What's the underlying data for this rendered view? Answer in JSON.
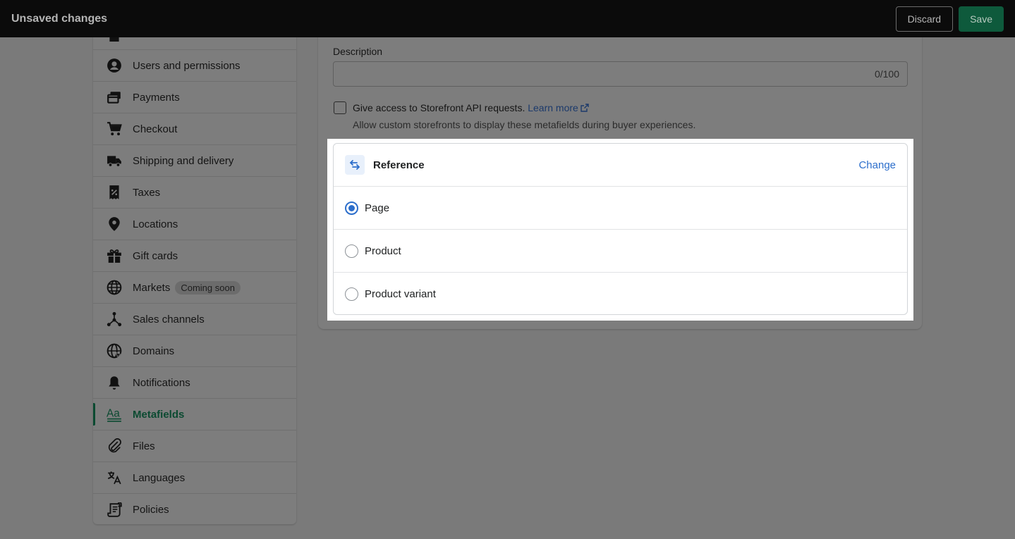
{
  "topbar": {
    "title": "Unsaved changes",
    "discard_label": "Discard",
    "save_label": "Save"
  },
  "sidebar": {
    "items": [
      {
        "label": "Users and permissions",
        "icon": "user-circle-icon"
      },
      {
        "label": "Payments",
        "icon": "payments-icon"
      },
      {
        "label": "Checkout",
        "icon": "cart-icon"
      },
      {
        "label": "Shipping and delivery",
        "icon": "truck-icon"
      },
      {
        "label": "Taxes",
        "icon": "tax-receipt-icon"
      },
      {
        "label": "Locations",
        "icon": "location-pin-icon"
      },
      {
        "label": "Gift cards",
        "icon": "gift-icon"
      },
      {
        "label": "Markets",
        "icon": "globe-icon",
        "badge": "Coming soon"
      },
      {
        "label": "Sales channels",
        "icon": "channels-icon"
      },
      {
        "label": "Domains",
        "icon": "globe-domain-icon"
      },
      {
        "label": "Notifications",
        "icon": "bell-icon"
      },
      {
        "label": "Metafields",
        "icon": "metafields-icon",
        "active": true
      },
      {
        "label": "Files",
        "icon": "paperclip-icon"
      },
      {
        "label": "Languages",
        "icon": "translate-icon"
      },
      {
        "label": "Policies",
        "icon": "policy-document-icon"
      }
    ]
  },
  "form": {
    "description_label": "Description",
    "description_value": "",
    "description_counter": "0/100",
    "storefront_checkbox_label": "Give access to Storefront API requests.",
    "storefront_checked": false,
    "learn_more_label": "Learn more",
    "storefront_help": "Allow custom storefronts to display these metafields during buyer experiences."
  },
  "reference": {
    "title": "Reference",
    "change_label": "Change",
    "options": [
      {
        "label": "Page",
        "selected": true
      },
      {
        "label": "Product",
        "selected": false
      },
      {
        "label": "Product variant",
        "selected": false
      }
    ]
  },
  "colors": {
    "accent_blue": "#2c6ecb",
    "active_green": "#0b4a31",
    "save_green": "#008060"
  }
}
